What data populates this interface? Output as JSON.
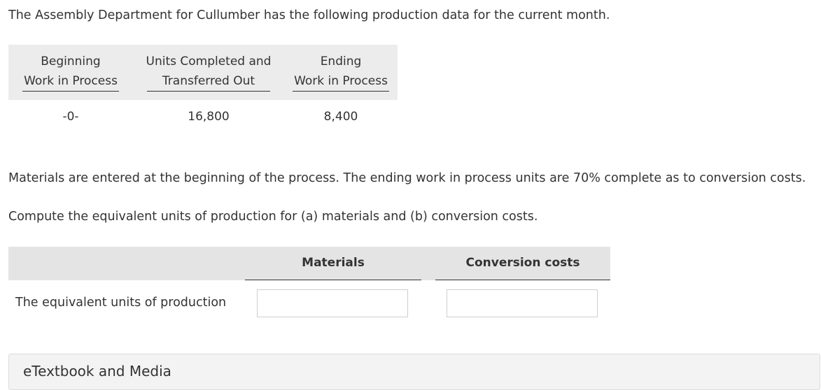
{
  "intro": "The Assembly Department for Cullumber has the following production data for the current month.",
  "production_table": {
    "headers": [
      {
        "line1": "Beginning",
        "line2": "Work in Process"
      },
      {
        "line1": "Units Completed and",
        "line2": "Transferred Out"
      },
      {
        "line1": "Ending",
        "line2": "Work in Process"
      }
    ],
    "values": [
      "-0-",
      "16,800",
      "8,400"
    ]
  },
  "materials_note": "Materials are entered at the beginning of the process. The ending work in process units are 70% complete as to conversion costs.",
  "instruction": "Compute the equivalent units of production for (a) materials and (b) conversion costs.",
  "answer_table": {
    "col_materials": "Materials",
    "col_conversion": "Conversion costs",
    "row_label": "The equivalent units of production",
    "materials_value": "",
    "conversion_value": ""
  },
  "media": {
    "label": "eTextbook and Media"
  }
}
